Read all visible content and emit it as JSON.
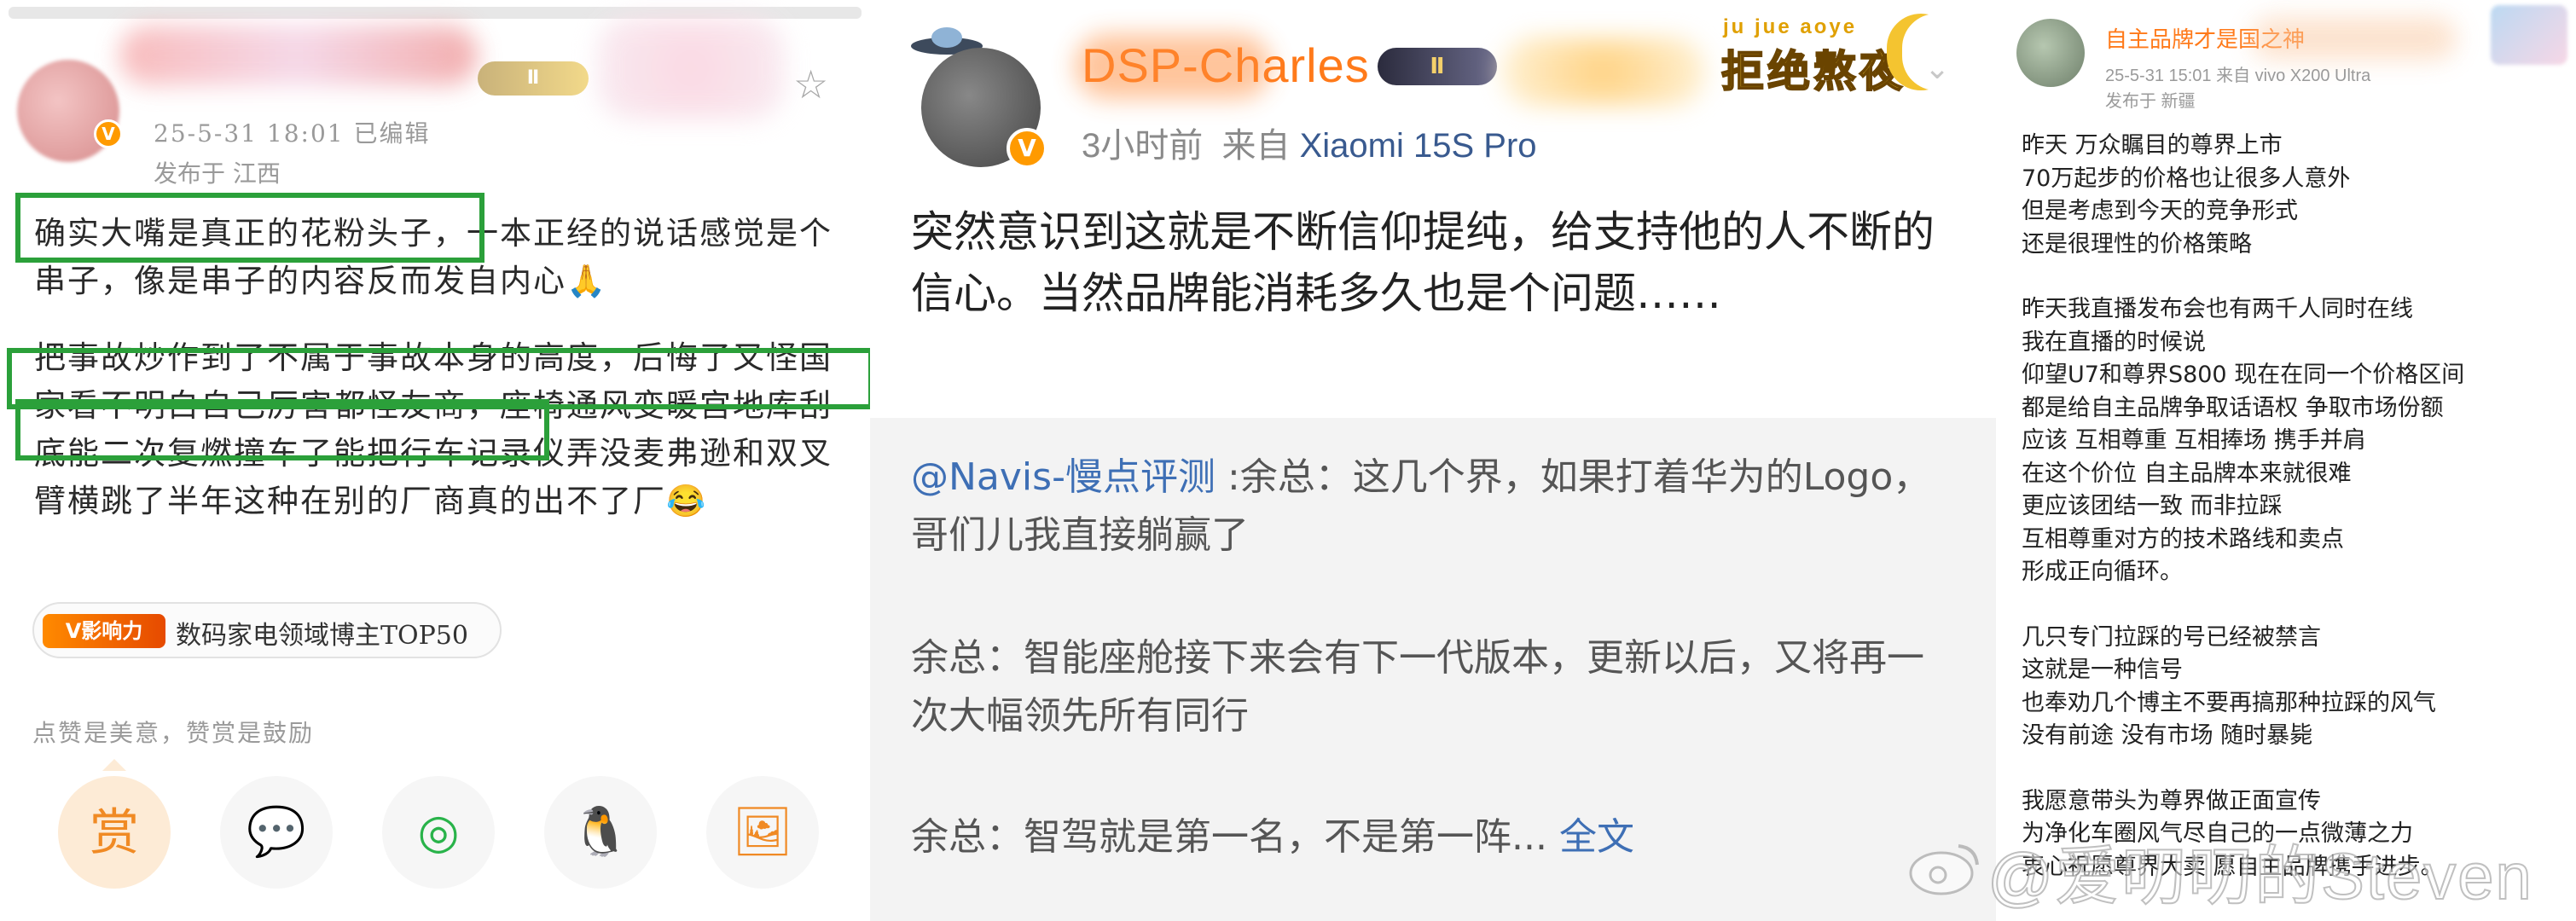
{
  "panel1": {
    "badge_level": "Ⅱ",
    "timestamp": "25-5-31 18:01  已编辑",
    "location": "发布于 江西",
    "paragraphs": [
      "确实大嘴是真正的花粉头子，一本正经的说话感觉是个串子，像是串子的内容反而发自内心🙏",
      "把事故炒作到了不属于事故本身的高度，后悔了又怪国家看不明白自己厉害都怪友商，座椅通风变暖宫地库刮底能二次复燃撞车了能把行车记录仪弄没麦弗逊和双叉臂横跳了半年这种在别的厂商真的出不了厂😂"
    ],
    "influence_badge": "V影响力",
    "influence_text": "数码家电领域博主TOP50",
    "reward_hint": "点赞是美意，赞赏是鼓励",
    "actions": [
      {
        "icon": "reward-icon",
        "glyph": "赏"
      },
      {
        "icon": "wechat-icon",
        "glyph": "💬"
      },
      {
        "icon": "moments-icon",
        "glyph": "◎"
      },
      {
        "icon": "qq-icon",
        "glyph": "🐧"
      },
      {
        "icon": "save-image-icon",
        "glyph": "🖼"
      }
    ],
    "highlight_color": "#2ba03a"
  },
  "panel2": {
    "name": "DSP-Charles",
    "badge_level": "Ⅱ",
    "deco_text_en": "ju jue aoye",
    "deco_text_cn": "拒绝熬夜",
    "time": "3小时前",
    "from_label": "来自",
    "device": "Xiaomi 15S Pro",
    "main_text": "突然意识到这就是不断信仰提纯，给支持他的人不断的信心。当然品牌能消耗多久也是个问题……",
    "quote": {
      "mention": "@Navis-慢点评测",
      "p1_rest": " :余总：这几个界，如果打着华为的Logo，哥们儿我直接躺赢了",
      "p2": "余总：智能座舱接下来会有下一代版本，更新以后，又将再一次大幅领先所有同行",
      "p3": "余总：智驾就是第一名，不是第一阵...",
      "more": " 全文"
    }
  },
  "panel3": {
    "name": "自主品牌才是国之神",
    "timestamp": "25-5-31 15:01  来自 vivo X200 Ultra",
    "location": "发布于 新疆",
    "paragraphs": [
      [
        "昨天 万众瞩目的尊界上市",
        "70万起步的价格也让很多人意外",
        "但是考虑到今天的竞争形式",
        "还是很理性的价格策略"
      ],
      [
        "昨天我直播发布会也有两千人同时在线",
        "我在直播的时候说",
        "仰望U7和尊界S800 现在在同一个价格区间",
        "都是给自主品牌争取话语权 争取市场份额",
        "应该 互相尊重 互相捧场 携手并肩",
        "在这个价位 自主品牌本来就很难",
        "更应该团结一致 而非拉踩",
        "互相尊重对方的技术路线和卖点",
        "形成正向循环。"
      ],
      [
        "几只专门拉踩的号已经被禁言",
        "这就是一种信号",
        "也奉劝几个博主不要再搞那种拉踩的风气",
        "没有前途 没有市场 随时暴毙"
      ],
      [
        "我愿意带头为尊界做正面宣传",
        "为净化车圈风气尽自己的一点微薄之力",
        "衷心祝愿尊界大卖 愿自主品牌携手进步。"
      ]
    ]
  },
  "watermark": "@爱叨叨的Steven"
}
